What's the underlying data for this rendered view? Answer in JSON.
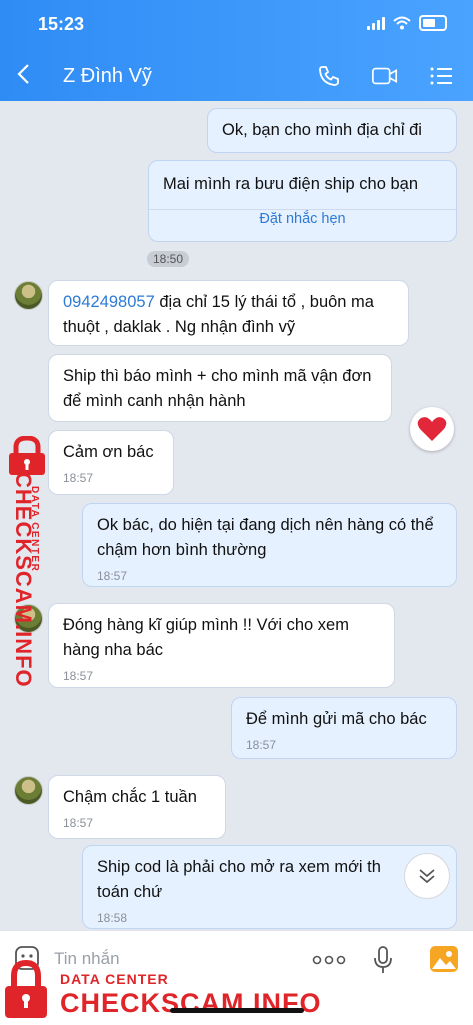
{
  "status": {
    "time": "15:23"
  },
  "header": {
    "title": "Z Đình Vỹ"
  },
  "chat": {
    "messages": [
      {
        "text": "Ok, bạn cho mình địa chỉ đi"
      },
      {
        "text": "Mai mình ra bưu điện ship cho bạn",
        "action": "Đặt nhắc hẹn"
      },
      {
        "time_chip": "18:50"
      },
      {
        "phone": "0942498057",
        "text_after_phone": " địa chỉ 15 lý thái tổ , buôn ma thuột , daklak . Ng nhận đình vỹ"
      },
      {
        "text": "Ship thì báo mình + cho mình mã vận đơn để mình canh nhận hành"
      },
      {
        "text": "Cảm ơn bác",
        "time": "18:57"
      },
      {
        "text": "Ok bác, do hiện tại đang dịch nên hàng có thể chậm hơn bình thường",
        "time": "18:57"
      },
      {
        "text": "Đóng hàng kĩ giúp mình !! Với cho xem hàng nha bác",
        "time": "18:57"
      },
      {
        "text": "Để mình gửi mã cho bác",
        "time": "18:57"
      },
      {
        "text": "Chậm chắc 1 tuần",
        "time": "18:57"
      },
      {
        "text": "Ship cod là phải cho mở ra xem mới th toán chứ",
        "time": "18:58"
      }
    ]
  },
  "watermark": {
    "top": "DATA CENTER",
    "main": "CHECKSCAM.INFO"
  },
  "input": {
    "placeholder": "Tin nhắn"
  },
  "colors": {
    "header": "#2f8cf5",
    "accent_red": "#e0252a",
    "link_blue": "#2e7ad6"
  }
}
